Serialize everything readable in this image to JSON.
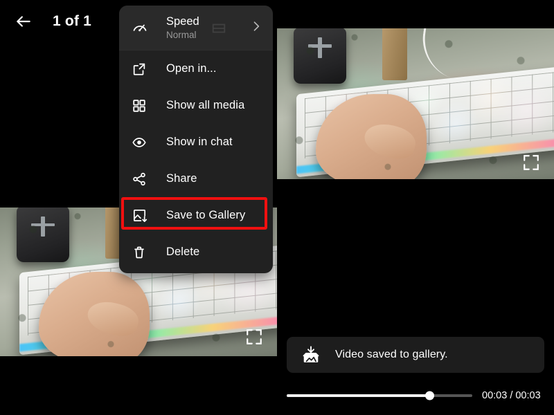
{
  "app": {
    "background_color": "#000000",
    "menu_background": "#212121",
    "highlight_color": "#f01010",
    "accent_text_color": "#ffffff"
  },
  "left_panel": {
    "topbar": {
      "back_icon": "arrow-left-icon",
      "counter_label": "1 of 1"
    },
    "media": {
      "fullscreen_icon": "fullscreen-icon"
    },
    "menu": {
      "speed": {
        "icon": "speedometer-icon",
        "label": "Speed",
        "value": "Normal",
        "chevron_icon": "chevron-right-icon"
      },
      "items": [
        {
          "icon": "external-link-icon",
          "label": "Open in...",
          "highlighted": false
        },
        {
          "icon": "grid-icon",
          "label": "Show all media",
          "highlighted": false
        },
        {
          "icon": "eye-icon",
          "label": "Show in chat",
          "highlighted": false
        },
        {
          "icon": "share-icon",
          "label": "Share",
          "highlighted": false
        },
        {
          "icon": "save-image-icon",
          "label": "Save to Gallery",
          "highlighted": true
        },
        {
          "icon": "trash-icon",
          "label": "Delete",
          "highlighted": false
        }
      ]
    }
  },
  "right_panel": {
    "media": {
      "fullscreen_icon": "fullscreen-icon"
    },
    "toast": {
      "icon": "save-to-gallery-icon",
      "message": "Video saved to gallery."
    },
    "player": {
      "progress_percent": 77,
      "time_label": "00:03 / 00:03"
    }
  }
}
